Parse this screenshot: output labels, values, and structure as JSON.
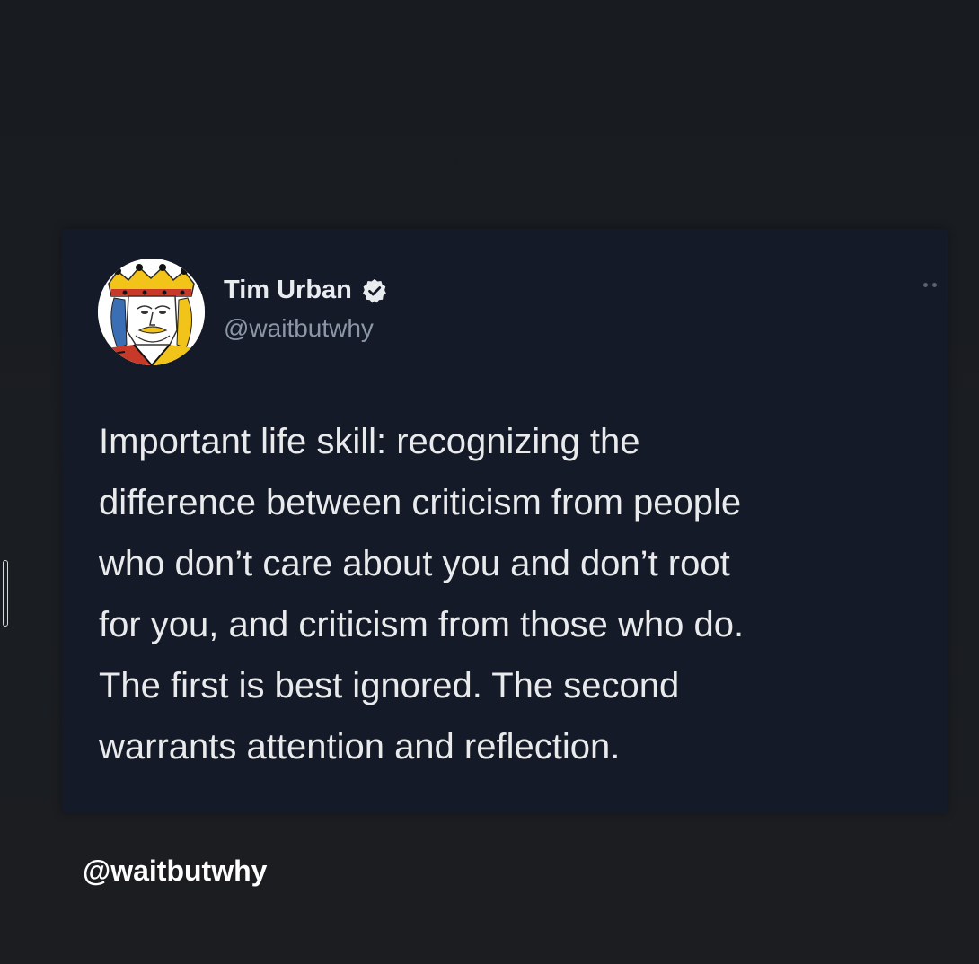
{
  "tweet": {
    "display_name": "Tim Urban",
    "handle": "@waitbutwhy",
    "text": "Important life skill: recognizing the\ndifference between criticism from people\nwho don’t care about you and don’t root\nfor you, and criticism from those who do.\nThe first is best ignored. The second\nwarrants attention and reflection.",
    "verified_icon": "verified-badge-icon",
    "more_icon": "more-options-icon",
    "avatar_icon": "king-card-avatar"
  },
  "watermark": {
    "text": "@waitbutwhy"
  },
  "colors": {
    "background": "#1a1c20",
    "card": "#141a27",
    "text": "#e8eaec",
    "handle": "#8b97a6"
  }
}
